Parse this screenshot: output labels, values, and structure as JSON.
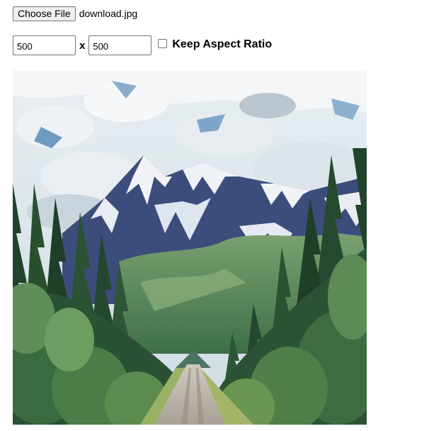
{
  "file_picker": {
    "button_label": "Choose File",
    "file_name": "download.jpg"
  },
  "resize": {
    "width_value": "500",
    "separator": "x",
    "height_value": "500",
    "keep_aspect_label": "Keep Aspect Ratio",
    "keep_aspect_checked": false
  },
  "preview": {
    "description_icon": "landscape-photo",
    "colors": {
      "sky": "#d9e4ec",
      "sky_blue": "#5f8fb8",
      "mountain": "#3a4a7a",
      "snow": "#f2f4f8",
      "slope_green": "#5c8a5a",
      "forest_dark": "#23462c",
      "forest_light": "#6f9a55",
      "road": "#b9b2a8"
    }
  }
}
